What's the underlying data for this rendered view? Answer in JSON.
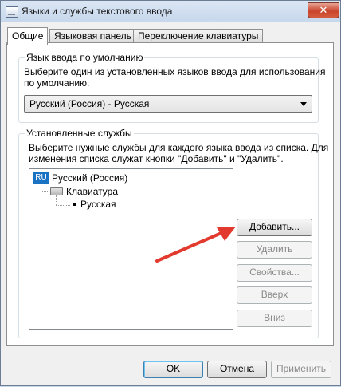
{
  "window": {
    "title": "Языки и службы текстового ввода",
    "close_glyph": "✕"
  },
  "tabs": [
    {
      "label": "Общие"
    },
    {
      "label": "Языковая панель"
    },
    {
      "label": "Переключение клавиатуры"
    }
  ],
  "default_lang_group": {
    "title": "Язык ввода по умолчанию",
    "desc1": "Выберите один из установленных языков ввода для использования",
    "desc2": "по умолчанию.",
    "select_value": "Русский (Россия) - Русская"
  },
  "services_group": {
    "title": "Установленные службы",
    "desc1": "Выберите нужные службы для каждого языка ввода из списка. Для",
    "desc2": "изменения списка служат кнопки \"Добавить\" и \"Удалить\".",
    "tree": {
      "lang_code": "RU",
      "lang_name": "Русский (Россия)",
      "category": "Клавиатура",
      "layout": "Русская"
    },
    "buttons": {
      "add": "Добавить...",
      "remove": "Удалить",
      "properties": "Свойства...",
      "up": "Вверх",
      "down": "Вниз"
    }
  },
  "footer": {
    "ok": "OK",
    "cancel": "Отмена",
    "apply": "Применить"
  },
  "colors": {
    "arrow": "#e23a2e",
    "lang_badge": "#1a73c2"
  }
}
